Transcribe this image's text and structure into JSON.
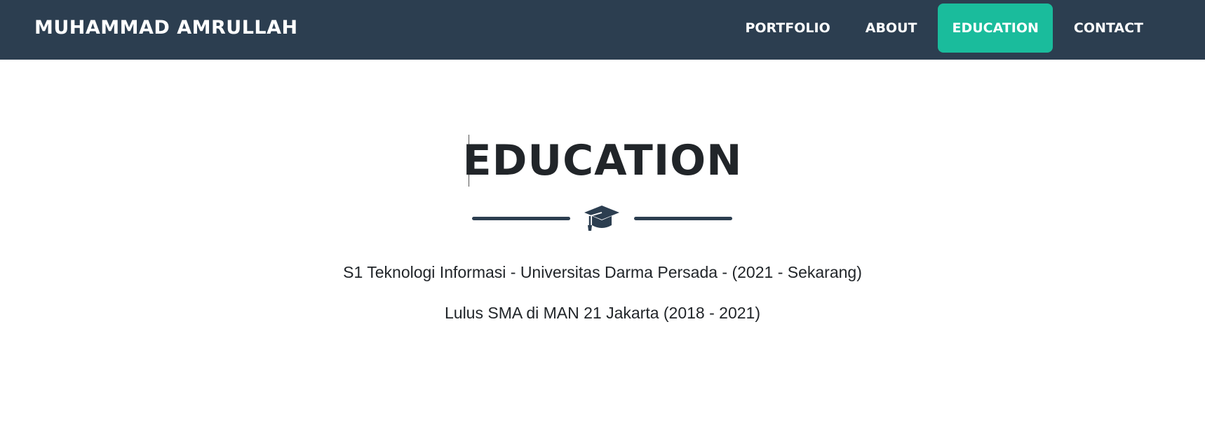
{
  "navbar": {
    "brand": "MUHAMMAD AMRULLAH",
    "items": [
      {
        "label": "PORTFOLIO",
        "active": false
      },
      {
        "label": "ABOUT",
        "active": false
      },
      {
        "label": "EDUCATION",
        "active": true
      },
      {
        "label": "CONTACT",
        "active": false
      }
    ]
  },
  "education": {
    "heading": "EDUCATION",
    "icon": "graduation-cap-icon",
    "entries": [
      "S1 Teknologi Informasi - Universitas Darma Persada - (2021 - Sekarang)",
      "Lulus SMA di MAN 21 Jakarta (2018 - 2021)"
    ]
  },
  "colors": {
    "navbar_bg": "#2c3e50",
    "accent": "#1abc9c",
    "text_dark": "#212529"
  }
}
